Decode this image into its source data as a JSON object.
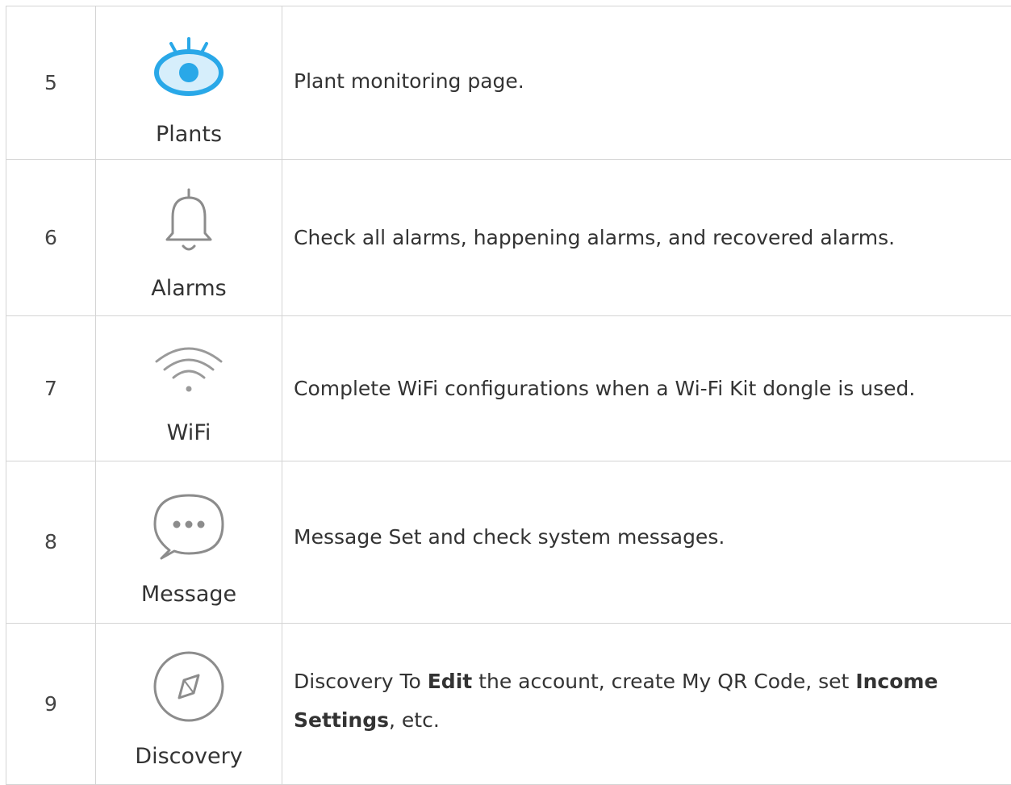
{
  "rows": [
    {
      "number": "5",
      "icon": "eye-icon",
      "icon_label": "Plants",
      "description": "Plant monitoring page.",
      "color": "#29a8e8"
    },
    {
      "number": "6",
      "icon": "bell-icon",
      "icon_label": "Alarms",
      "description": "Check all alarms, happening alarms, and recovered alarms.",
      "color": "#8c8c8c"
    },
    {
      "number": "7",
      "icon": "wifi-icon",
      "icon_label": "WiFi",
      "description": "Complete WiFi configurations when a Wi-Fi Kit dongle is used.",
      "color": "#9a9a9a"
    },
    {
      "number": "8",
      "icon": "chat-bubble-icon",
      "icon_label": "Message",
      "description": "Message Set and check system messages.",
      "color": "#8c8c8c"
    },
    {
      "number": "9",
      "icon": "compass-icon",
      "icon_label": "Discovery",
      "description_parts": {
        "p1": "Discovery To ",
        "b1": "Edit",
        "p2": " the account, create My QR Code, set ",
        "b2": "Income Settings",
        "p3": ", etc."
      },
      "color": "#8c8c8c"
    }
  ]
}
